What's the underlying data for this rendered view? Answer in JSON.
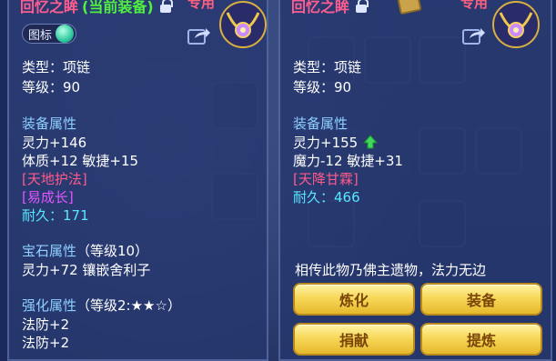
{
  "colors": {
    "title": "#ff5d8f",
    "equipped": "#50f040",
    "section": "#8fd0ff",
    "special_pink": "#ff5a8a",
    "special_purple": "#e256ff",
    "durability": "#57e8ff",
    "button_bg": "#f7d85a",
    "button_text": "#7a4608",
    "up_arrow": "#3fd85a"
  },
  "left": {
    "item_name": "回忆之眸",
    "equipped_tag": "(当前装备)",
    "exclusive": "专用",
    "toggle_label": "图标",
    "type": "类型：项链",
    "level": "等级：90",
    "section_equip": "装备属性",
    "attr_1": "灵力+146",
    "attr_2": "体质+12 敏捷+15",
    "special_1": "[天地护法]",
    "special_2": "[易成长]",
    "durability_label": "耐久：",
    "durability_value": "171",
    "section_gem": "宝石属性",
    "gem_level": "（等级10）",
    "gem_attr": "灵力+72 镶嵌舍利子",
    "section_enhance": "强化属性",
    "enhance_level": "（等级2:★★☆）",
    "enhance_1": "法防+2",
    "enhance_2": "法防+2"
  },
  "right": {
    "item_name": "回忆之眸",
    "exclusive": "专用",
    "type": "类型：项链",
    "level": "等级：90",
    "section_equip": "装备属性",
    "attr_1": "灵力+155",
    "attr_2": "魔力-12 敏捷+31",
    "special_1": "[天降甘霖]",
    "durability_label": "耐久：",
    "durability_value": "466",
    "description": "相传此物乃佛主遗物，法力无边",
    "buttons": {
      "refine": "炼化",
      "equip": "装备",
      "donate": "捐献",
      "extract": "提炼"
    }
  }
}
